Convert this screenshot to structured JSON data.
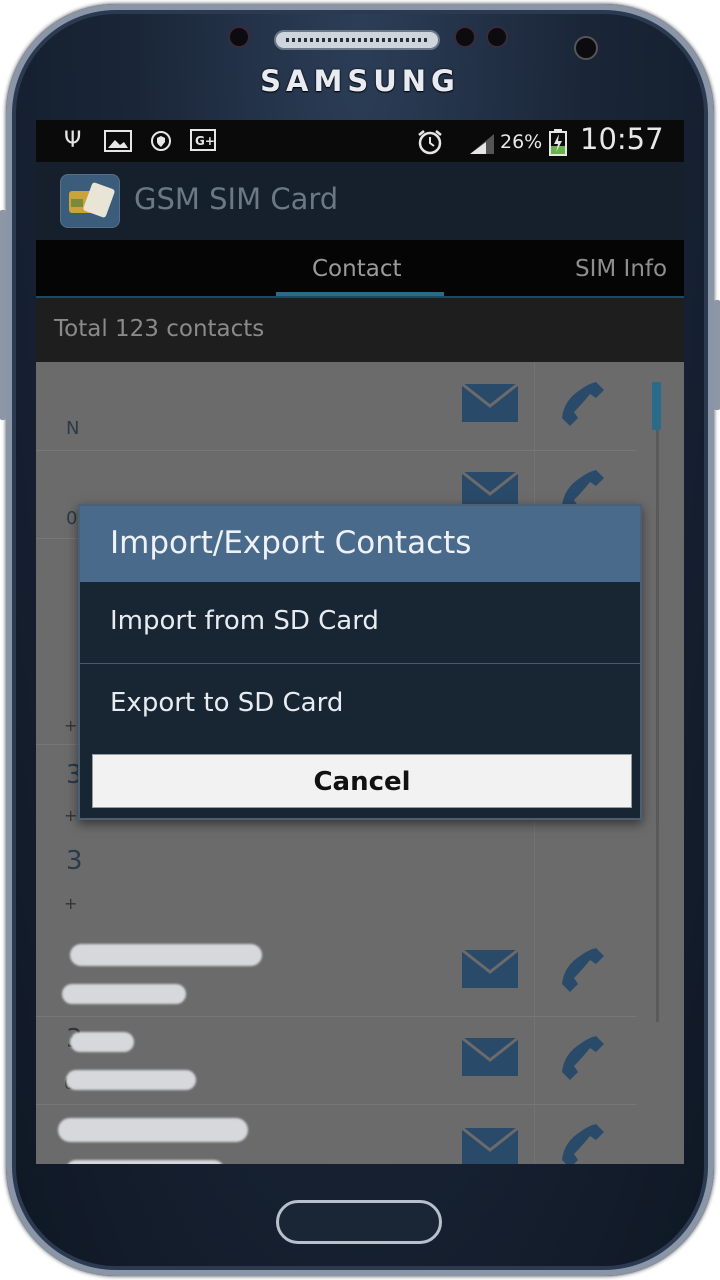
{
  "device": {
    "brand": "SAMSUNG"
  },
  "statusbar": {
    "battery": "26%",
    "time": "10:57",
    "icons": [
      "usb-icon",
      "image-icon",
      "shield-icon",
      "google-plus-icon",
      "alarm-icon",
      "signal-icon",
      "battery-charging-icon"
    ]
  },
  "app": {
    "title": "GSM SIM Card"
  },
  "tabs": [
    {
      "label": "Contact",
      "active": true
    },
    {
      "label": "SIM Info",
      "active": false
    }
  ],
  "summary": {
    "total": "Total 123 contacts"
  },
  "list": {
    "row1": {
      "letter": "N"
    },
    "row2": {
      "letter": "0"
    },
    "row3": {
      "sub": "+"
    },
    "row4": {
      "letter": "3",
      "sub": "+"
    },
    "row5": {
      "letter": "3",
      "sub": "+"
    },
    "row6": {
      "letter": "3",
      "sub": "0"
    }
  },
  "dialog": {
    "title": "Import/Export Contacts",
    "items": [
      {
        "label": "Import from SD Card"
      },
      {
        "label": "Export to SD Card"
      }
    ],
    "cancel_label": "Cancel"
  },
  "colors": {
    "accent": "#2a6b8a",
    "dialog_title_bg": "#4a6a8c",
    "dialog_bg": "#182634",
    "icon_blue": "#2a4a6a"
  }
}
